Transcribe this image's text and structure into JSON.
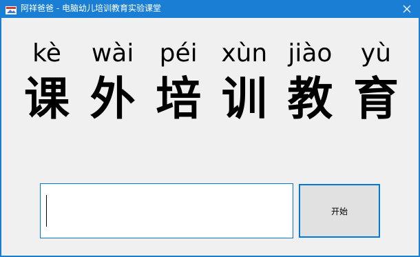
{
  "window": {
    "title": "阿祥爸爸 - 电脑幼儿培训教育实验课堂",
    "close_icon": "close-icon",
    "app_icon": "app-icon",
    "accent_color": "#1a7fd4"
  },
  "lesson": {
    "pinyin": [
      "kè",
      "wài",
      "péi",
      "xùn",
      "jiào",
      "yù"
    ],
    "characters": [
      "课",
      "外",
      "培",
      "训",
      "教",
      "育"
    ]
  },
  "answer": {
    "value": "",
    "placeholder": ""
  },
  "start_button": {
    "label": "开始"
  }
}
